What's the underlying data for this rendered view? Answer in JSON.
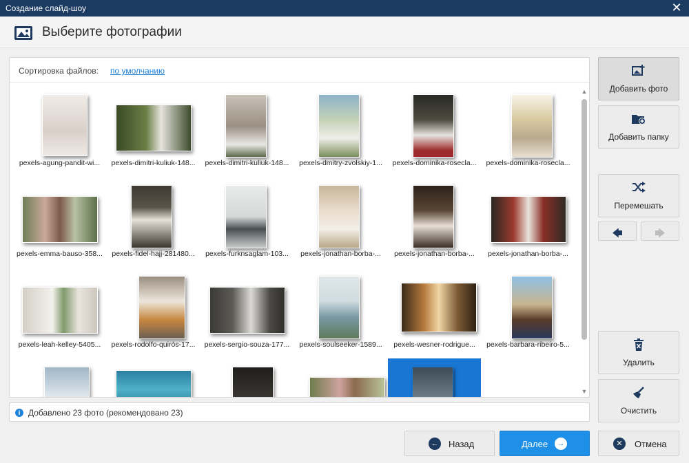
{
  "window": {
    "title": "Создание слайд-шоу"
  },
  "header": {
    "title": "Выберите фотографии",
    "icon": "picture-icon"
  },
  "sort": {
    "label": "Сортировка файлов:",
    "value": "по умолчанию"
  },
  "photos": [
    "pexels-agung-pandit-wi...",
    "pexels-dimitri-kuliuk-148...",
    "pexels-dimitri-kuliuk-148...",
    "pexels-dmitry-zvolskiy-1...",
    "pexels-dominika-rosecla...",
    "pexels-dominika-rosecla...",
    "pexels-emma-bauso-358...",
    "pexels-fidel-hajj-281480...",
    "pexels-furknsaglam-103...",
    "pexels-jonathan-borba-...",
    "pexels-jonathan-borba-...",
    "pexels-jonathan-borba-...",
    "pexels-leah-kelley-5405...",
    "pexels-rodolfo-quirós-17...",
    "pexels-sergio-souza-177...",
    "pexels-soulseeker-1589...",
    "pexels-wesner-rodrigue...",
    "pexels-barbara-ribeiro-5..."
  ],
  "status": {
    "text": "Добавлено 23 фото (рекомендовано 23)"
  },
  "side": {
    "add_photo": "Добавить фото",
    "add_folder": "Добавить папку",
    "shuffle": "Перемешать",
    "delete": "Удалить",
    "clear": "Очистить"
  },
  "nav": {
    "back": "Назад",
    "next": "Далее",
    "cancel": "Отмена"
  },
  "colors": {
    "titlebar": "#1c3b63",
    "accent": "#1e90e8",
    "link": "#1f7fd1",
    "selection": "#1976d2"
  }
}
